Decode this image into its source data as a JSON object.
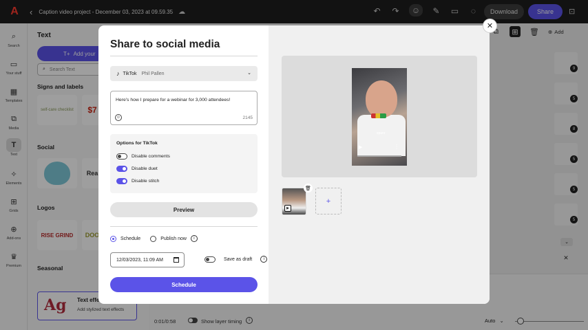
{
  "topbar": {
    "logo": "A",
    "project_title": "Caption video project - December 03, 2023 at 09.59.35",
    "download_label": "Download",
    "share_label": "Share",
    "icons": [
      "undo-icon",
      "redo-icon",
      "user-icon",
      "lightbulb-icon",
      "comment-icon",
      "chat-icon",
      "more-icon"
    ]
  },
  "rail": {
    "items": [
      {
        "label": "Search",
        "icon": "⌕"
      },
      {
        "label": "Your stuff",
        "icon": "▭"
      },
      {
        "label": "Templates",
        "icon": "▦"
      },
      {
        "label": "Media",
        "icon": "⧉"
      },
      {
        "label": "Text",
        "icon": "T"
      },
      {
        "label": "Elements",
        "icon": "✧"
      },
      {
        "label": "Grids",
        "icon": "⊞"
      },
      {
        "label": "Add-ons",
        "icon": "⊕"
      },
      {
        "label": "Premium",
        "icon": "♛"
      }
    ]
  },
  "panel": {
    "title": "Text",
    "add_text_label": "Add your",
    "search_placeholder": "Search Text",
    "sections": {
      "signs": "Signs and labels",
      "social": "Social",
      "logos": "Logos",
      "seasonal": "Seasonal"
    },
    "thumbs": {
      "signs_1": "self-care checklist",
      "signs_2": "$7",
      "social_1": "",
      "social_2": "Rea",
      "logos_1": "RISE GRIND",
      "logos_2": "DOO"
    },
    "effects": {
      "glyph": "Ag",
      "title": "Text effe",
      "subtitle": "Add stylized text effects"
    }
  },
  "canvas": {
    "add_label": "Add",
    "scene_badges": [
      "9",
      "5",
      "8",
      "5",
      "5",
      "5"
    ]
  },
  "timeline": {
    "time": "0:01/0:58",
    "layer_timing_label": "Show layer timing",
    "zoom_label": "Auto"
  },
  "modal": {
    "title": "Share to social media",
    "account": {
      "platform": "TikTok",
      "name": "Phil Pallen"
    },
    "caption": {
      "text": "Here's how I prepare for a webinar for 3,000 attendees!",
      "char_count": "2145"
    },
    "options": {
      "title": "Options for TikTok",
      "items": [
        {
          "label": "Disable comments",
          "enabled": false
        },
        {
          "label": "Disable duet",
          "enabled": true
        },
        {
          "label": "Disable stitch",
          "enabled": true
        }
      ]
    },
    "preview_label": "Preview",
    "schedule_option": "Schedule",
    "publish_now_option": "Publish now",
    "selected_option": "Schedule",
    "date_value": "12/03/2023, 11:09 AM",
    "save_as_draft_label": "Save as draft",
    "schedule_button": "Schedule",
    "video_caption": "spare",
    "colors": {
      "accent": "#5b53e8"
    }
  }
}
